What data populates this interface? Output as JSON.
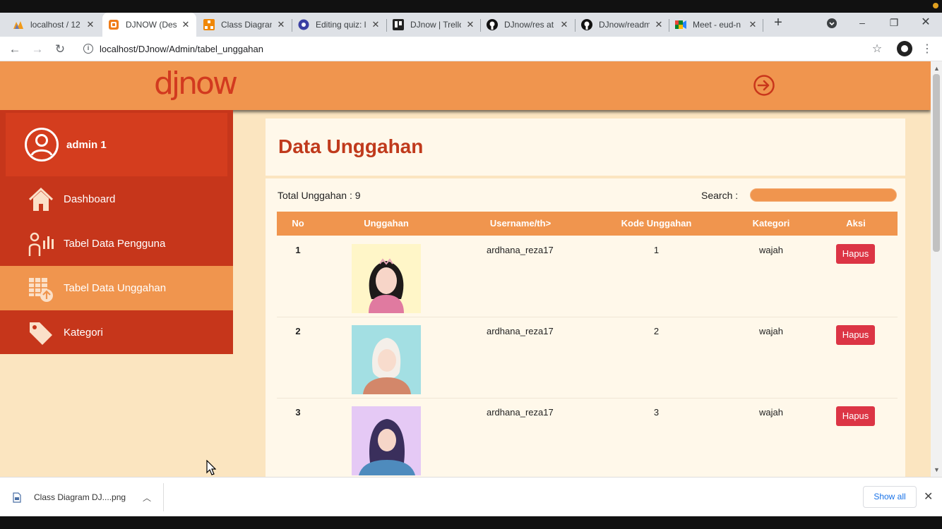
{
  "browser": {
    "tabs": [
      {
        "title": "localhost / 12",
        "icon": "phpmyadmin-icon"
      },
      {
        "title": "DJNOW (Desi",
        "icon": "sketch-icon"
      },
      {
        "title": "Class Diagran",
        "icon": "diagram-icon"
      },
      {
        "title": "Editing quiz: l",
        "icon": "quiz-icon"
      },
      {
        "title": "DJnow | Trello",
        "icon": "trello-icon"
      },
      {
        "title": "DJnow/res at",
        "icon": "github-icon"
      },
      {
        "title": "DJnow/readm",
        "icon": "github-icon"
      },
      {
        "title": "Meet - eud-n",
        "icon": "meet-icon"
      }
    ],
    "new_tab": "+",
    "url": "localhost/DJnow/Admin/tabel_unggahan"
  },
  "header": {
    "logo": "djnow"
  },
  "sidebar": {
    "user_name": "admin 1",
    "items": [
      {
        "label": "Dashboard",
        "icon": "home-icon",
        "active": false
      },
      {
        "label": "Tabel Data Pengguna",
        "icon": "users-chart-icon",
        "active": false
      },
      {
        "label": "Tabel Data Unggahan",
        "icon": "upload-table-icon",
        "active": true
      },
      {
        "label": "Kategori",
        "icon": "tag-icon",
        "active": false
      }
    ]
  },
  "main": {
    "title": "Data Unggahan",
    "total_label": "Total Unggahan : 9",
    "search_label": "Search :",
    "columns": [
      "No",
      "Unggahan",
      "Username/th>",
      "Kode Unggahan",
      "Kategori",
      "Aksi"
    ],
    "rows": [
      {
        "no": "1",
        "username": "ardhana_reza17",
        "kode": "1",
        "kategori": "wajah",
        "action": "Hapus",
        "image_bg": "#fff6c8"
      },
      {
        "no": "2",
        "username": "ardhana_reza17",
        "kode": "2",
        "kategori": "wajah",
        "action": "Hapus",
        "image_bg": "#a3dfe3"
      },
      {
        "no": "3",
        "username": "ardhana_reza17",
        "kode": "3",
        "kategori": "wajah",
        "action": "Hapus",
        "image_bg": "#e5c9f5"
      }
    ]
  },
  "downloads": {
    "file": "Class Diagram DJ....png",
    "show_all": "Show all"
  },
  "colors": {
    "accent": "#f0954e",
    "sidebar": "#c6361b",
    "title": "#c03a1c",
    "danger": "#dc3545",
    "background": "#fbe5c0"
  }
}
